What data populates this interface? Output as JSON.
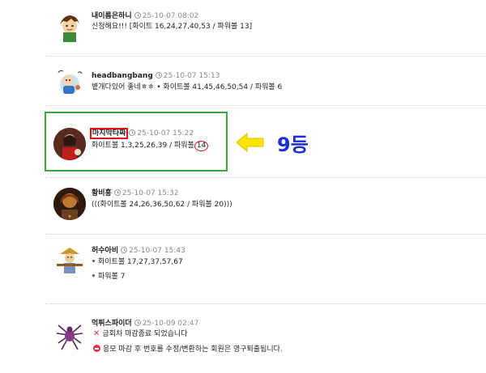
{
  "comments": [
    {
      "nick": "내이름은하니",
      "date": "25-10-07 08:02",
      "lines": [
        "신청해요!!! [화이트 16,24,27,40,53 / 파워볼 13]"
      ]
    },
    {
      "nick": "headbangbang",
      "date": "25-10-07 15:13",
      "lines": [
        "볕개다있어 좋네ㅎㅎ • 화이트볼 41,45,46,50,54 / 파워볼 6"
      ]
    },
    {
      "nick": "마지막타짜",
      "date": "25-10-07 15:22",
      "line_prefix": "화이트볼 1,3,25,26,39 / 파워볼",
      "powerball": "14"
    },
    {
      "nick": "황비홍",
      "date": "25-10-07 15:32",
      "lines": [
        "(((화이트볼 24,26,36,50,62 / 파워볼 20)))"
      ]
    },
    {
      "nick": "허수아비",
      "date": "25-10-07 15:43",
      "lines": [
        "화이트볼 17,27,37,57,67",
        "파워볼 7"
      ]
    },
    {
      "nick": "먹튀스파이더",
      "date": "25-10-09 02:47",
      "lines": [
        "금회차 마감종료 되었습니다",
        "응모 마감 후 번호를 수정/변환하는 회원은 영구퇴출됩니다."
      ]
    }
  ],
  "annotation": {
    "rank_label": "9등",
    "arrow_color": "#ffe500",
    "box_color": "#3aa63a",
    "mark_color": "#e01010"
  },
  "icons": [
    "clock-icon",
    "x-icon",
    "minus-circle-icon",
    "left-arrow-icon"
  ]
}
